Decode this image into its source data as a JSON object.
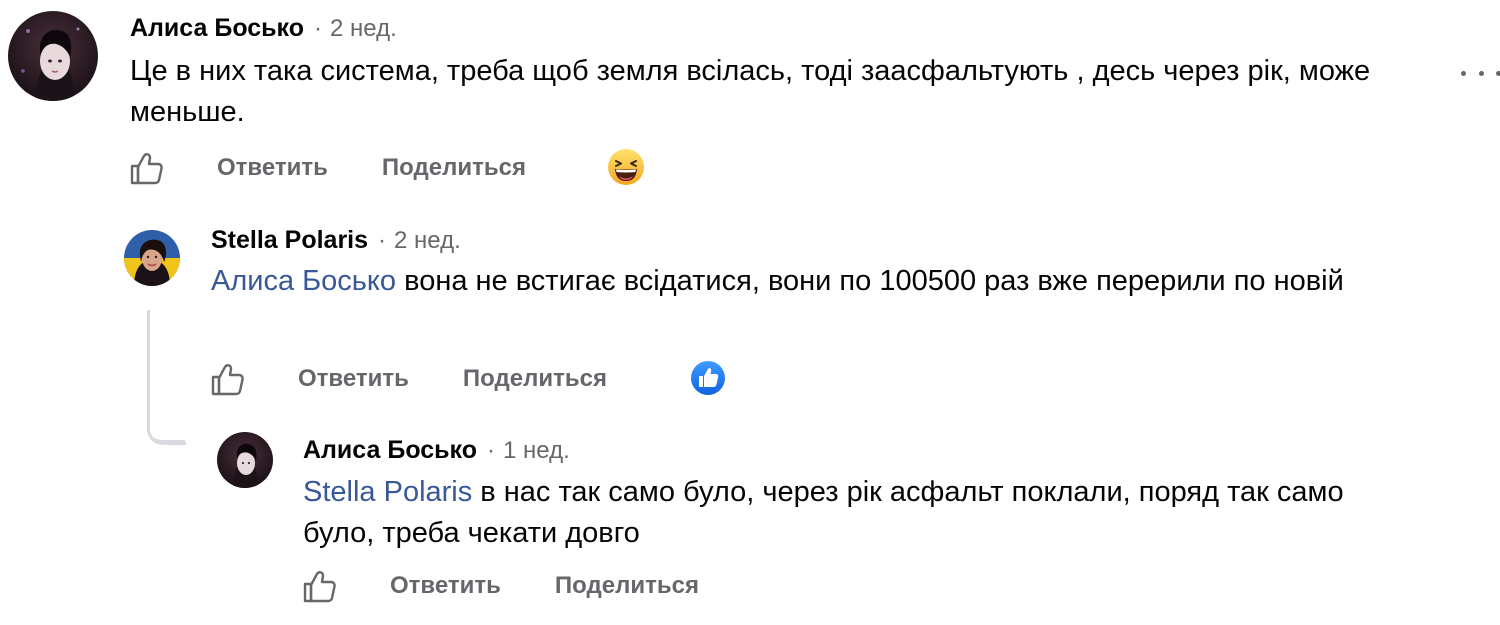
{
  "comments": [
    {
      "author": "Алиса Босько",
      "time": "2 нед.",
      "text": "Це в них така система, треба щоб земля всілась, тоді заасфальтують , десь через рік, може меньше.",
      "reply_label": "Ответить",
      "share_label": "Поделиться",
      "reaction": "haha-emoji"
    },
    {
      "author": "Stella Polaris",
      "time": "2 нед.",
      "mention": "Алиса Босько",
      "text": " вона не встигає всідатися, вони по 100500 раз вже перерили по новій",
      "reply_label": "Ответить",
      "share_label": "Поделиться",
      "reaction": "like-reaction"
    },
    {
      "author": "Алиса Босько",
      "time": "1 нед.",
      "mention": "Stella Polaris",
      "text": " в нас так само було, через рік асфальт поклали, поряд так само було, треба чекати довго",
      "reply_label": "Ответить",
      "share_label": "Поделиться"
    }
  ],
  "separator": "·",
  "icons": {
    "like": "thumbs-up-outline-icon",
    "more": "more-options-icon"
  },
  "colors": {
    "mention": "#385898",
    "secondary_text": "#65676b",
    "like_blue": "#1877f2",
    "thread_line": "#d8dadf"
  }
}
